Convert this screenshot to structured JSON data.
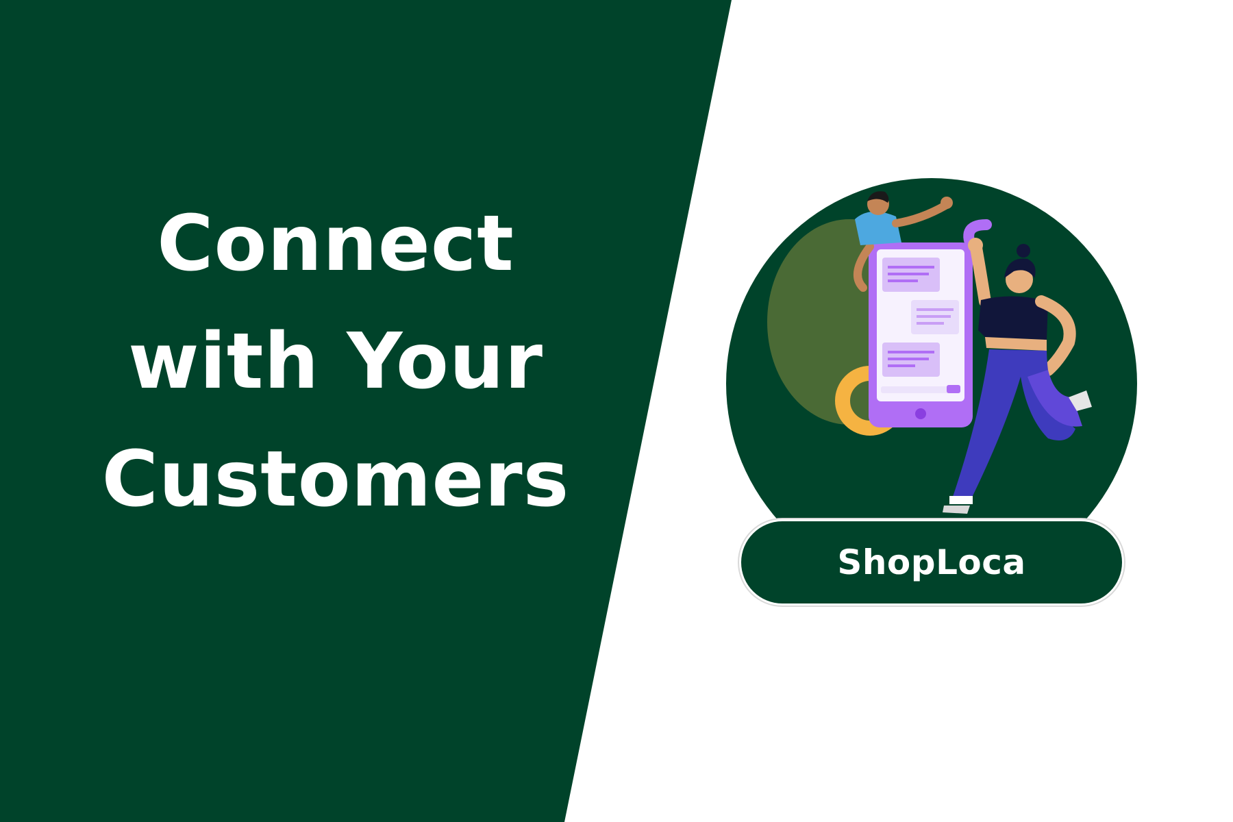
{
  "colors": {
    "brand_green": "#00432a",
    "white": "#ffffff",
    "phone_purple": "#b06ef5",
    "chat_bubble": "#d9bff8",
    "pants_blue": "#3e3bbd",
    "accent_yellow": "#f5b342",
    "skin_tan": "#e8b07f"
  },
  "headline": {
    "line1": "Connect",
    "line2": "with Your",
    "line3": "Customers"
  },
  "brand": {
    "name": "ShopLoca"
  },
  "illustration": {
    "icons": [
      "smartphone-chat-icon",
      "person-waving-icon",
      "person-leaping-icon"
    ]
  }
}
